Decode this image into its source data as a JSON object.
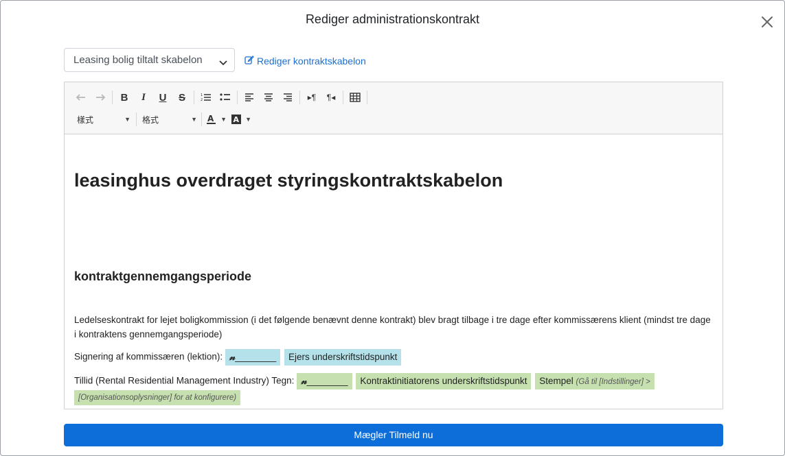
{
  "modal": {
    "title": "Rediger administrationskontrakt",
    "close_icon": "close-icon"
  },
  "template": {
    "selected": "Leasing bolig tiltalt skabelon",
    "edit_link": "Rediger kontraktskabelon"
  },
  "toolbar": {
    "row1": [
      "undo-icon",
      "redo-icon",
      "bold-icon",
      "italic-icon",
      "underline-icon",
      "strikethrough-icon",
      "ordered-list-icon",
      "unordered-list-icon",
      "align-left-icon",
      "align-center-icon",
      "align-right-icon",
      "ltr-icon",
      "rtl-icon",
      "table-icon"
    ],
    "style_dropdown": "樣式",
    "format_dropdown": "格式",
    "text_color_icon": "text-color-icon",
    "bg_color_icon": "background-color-icon"
  },
  "document": {
    "heading": "leasinghus overdraget styringskontraktskabelon",
    "subheading": "kontraktgennemgangsperiode",
    "paragraph": "Ledelseskontrakt for lejet boligkommission (i det følgende benævnt denne kontrakt) blev bragt tilbage i tre dage efter kommissærens klient (mindst tre dage i kontraktens gennemgangsperiode)",
    "sign1": {
      "label": "Signering af kommissæren (lektion):",
      "signature_line": "________",
      "time_chip": "Ejers underskriftstidspunkt"
    },
    "sign2": {
      "label": "Tillid (Rental Residential Management Industry) Tegn:",
      "signature_line": "________",
      "time_chip": "Kontraktinitiatorens underskriftstidspunkt",
      "stamp_label": "Stempel",
      "stamp_hint": "(Gå til [Indstillinger] >",
      "stamp_hint2": "[Organisationsoplysninger] for at konfigurere)"
    }
  },
  "actions": {
    "submit": "Mægler Tilmeld nu"
  },
  "colors": {
    "primary": "#0d6ed9",
    "chip_blue": "#b5e2ea",
    "chip_green": "#c6e0b0",
    "link": "#1a6fd0"
  }
}
